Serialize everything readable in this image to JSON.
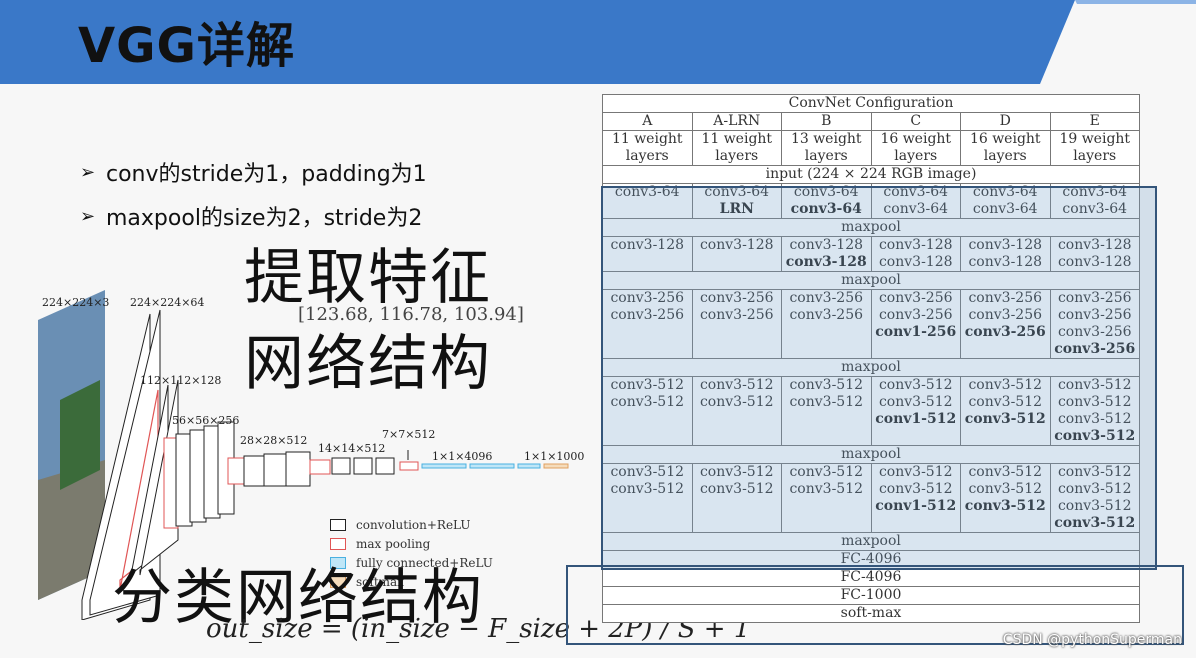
{
  "header": {
    "title": "VGG详解",
    "banner_color": "#3a78c8"
  },
  "bullets": [
    "conv的stride为1，padding为1",
    "maxpool的size为2，stride为2"
  ],
  "big_labels": {
    "extract": "提取特征",
    "network1": "网络结构",
    "classify": "分类网络结构"
  },
  "mean_values": "[123.68, 116.78, 103.94]",
  "formula": "out_size = (in_size − F_size + 2P) / S + 1",
  "watermark": "CSDN @pythonSuperman",
  "arch": {
    "labels": [
      "224×224×3",
      "224×224×64",
      "112×112×128",
      "56×56×256",
      "28×28×512",
      "14×14×512",
      "7×7×512",
      "1×1×4096",
      "1×1×1000"
    ],
    "legend": [
      "convolution+ReLU",
      "max pooling",
      "fully connected+ReLU",
      "softmax"
    ],
    "colors": {
      "conv": "#222222",
      "pool": "#e05555",
      "fc": "#4ab0e0",
      "softmax": "#e0a060"
    }
  },
  "table": {
    "caption": "ConvNet Configuration",
    "columns": [
      {
        "name": "A",
        "desc": "11 weight layers"
      },
      {
        "name": "A-LRN",
        "desc": "11 weight layers"
      },
      {
        "name": "B",
        "desc": "13 weight layers"
      },
      {
        "name": "C",
        "desc": "16 weight layers"
      },
      {
        "name": "D",
        "desc": "16 weight layers"
      },
      {
        "name": "E",
        "desc": "19 weight layers"
      }
    ],
    "input": "input (224 × 224 RGB image)",
    "maxpool": "maxpool",
    "blocks": [
      [
        [
          "conv3-64"
        ],
        [
          "conv3-64",
          "*LRN"
        ],
        [
          "conv3-64",
          "*conv3-64"
        ],
        [
          "conv3-64",
          "conv3-64"
        ],
        [
          "conv3-64",
          "conv3-64"
        ],
        [
          "conv3-64",
          "conv3-64"
        ]
      ],
      [
        [
          "conv3-128"
        ],
        [
          "conv3-128"
        ],
        [
          "conv3-128",
          "*conv3-128"
        ],
        [
          "conv3-128",
          "conv3-128"
        ],
        [
          "conv3-128",
          "conv3-128"
        ],
        [
          "conv3-128",
          "conv3-128"
        ]
      ],
      [
        [
          "conv3-256",
          "conv3-256"
        ],
        [
          "conv3-256",
          "conv3-256"
        ],
        [
          "conv3-256",
          "conv3-256"
        ],
        [
          "conv3-256",
          "conv3-256",
          "*conv1-256"
        ],
        [
          "conv3-256",
          "conv3-256",
          "*conv3-256"
        ],
        [
          "conv3-256",
          "conv3-256",
          "conv3-256",
          "*conv3-256"
        ]
      ],
      [
        [
          "conv3-512",
          "conv3-512"
        ],
        [
          "conv3-512",
          "conv3-512"
        ],
        [
          "conv3-512",
          "conv3-512"
        ],
        [
          "conv3-512",
          "conv3-512",
          "*conv1-512"
        ],
        [
          "conv3-512",
          "conv3-512",
          "*conv3-512"
        ],
        [
          "conv3-512",
          "conv3-512",
          "conv3-512",
          "*conv3-512"
        ]
      ],
      [
        [
          "conv3-512",
          "conv3-512"
        ],
        [
          "conv3-512",
          "conv3-512"
        ],
        [
          "conv3-512",
          "conv3-512"
        ],
        [
          "conv3-512",
          "conv3-512",
          "*conv1-512"
        ],
        [
          "conv3-512",
          "conv3-512",
          "*conv3-512"
        ],
        [
          "conv3-512",
          "conv3-512",
          "conv3-512",
          "*conv3-512"
        ]
      ]
    ],
    "tail": [
      "maxpool",
      "FC-4096",
      "FC-4096",
      "FC-1000",
      "soft-max"
    ]
  }
}
